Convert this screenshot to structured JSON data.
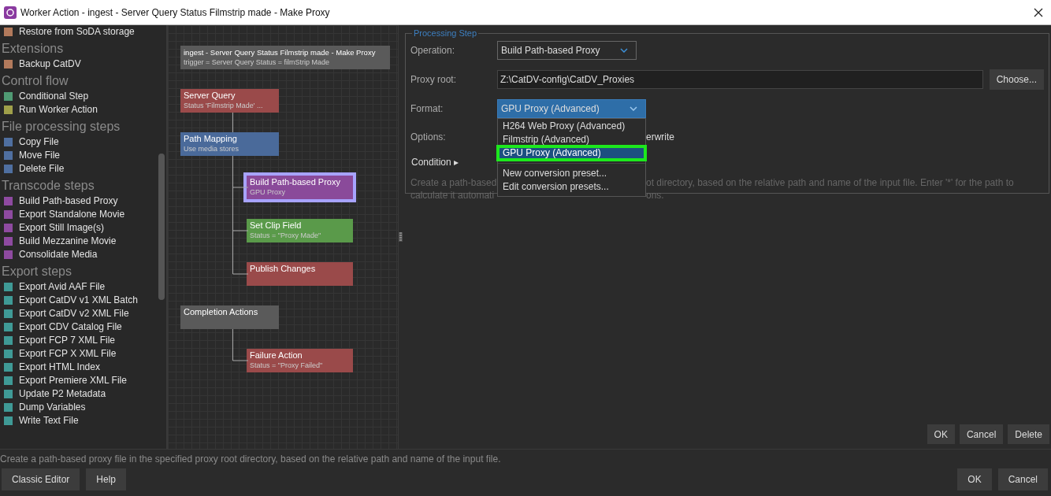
{
  "window": {
    "title": "Worker Action - ingest - Server Query Status Filmstrip made - Make Proxy"
  },
  "palette": [
    {
      "items": [
        {
          "label": "Restore from SoDA storage",
          "color": "#b27a5c"
        }
      ]
    },
    {
      "heading": "Extensions",
      "items": [
        {
          "label": "Backup CatDV",
          "color": "#b27a5c"
        }
      ]
    },
    {
      "heading": "Control flow",
      "items": [
        {
          "label": "Conditional Step",
          "color": "#4f9a73"
        },
        {
          "label": "Run Worker Action",
          "color": "#a0a04a"
        }
      ]
    },
    {
      "heading": "File processing steps",
      "items": [
        {
          "label": "Copy File",
          "color": "#4f6fa0"
        },
        {
          "label": "Move File",
          "color": "#4f6fa0"
        },
        {
          "label": "Delete File",
          "color": "#4f6fa0"
        }
      ]
    },
    {
      "heading": "Transcode steps",
      "items": [
        {
          "label": "Build Path-based Proxy",
          "color": "#8e4aa0"
        },
        {
          "label": "Export Standalone Movie",
          "color": "#8e4aa0"
        },
        {
          "label": "Export Still Image(s)",
          "color": "#8e4aa0"
        },
        {
          "label": "Build Mezzanine Movie",
          "color": "#8e4aa0"
        },
        {
          "label": "Consolidate Media",
          "color": "#8e4aa0"
        }
      ]
    },
    {
      "heading": "Export steps",
      "items": [
        {
          "label": "Export Avid AAF File",
          "color": "#3f9a96"
        },
        {
          "label": "Export CatDV v1 XML Batch",
          "color": "#3f9a96"
        },
        {
          "label": "Export CatDV v2 XML File",
          "color": "#3f9a96"
        },
        {
          "label": "Export CDV Catalog File",
          "color": "#3f9a96"
        },
        {
          "label": "Export FCP 7 XML File",
          "color": "#3f9a96"
        },
        {
          "label": "Export FCP X XML File",
          "color": "#3f9a96"
        },
        {
          "label": "Export HTML Index",
          "color": "#3f9a96"
        },
        {
          "label": "Export Premiere XML File",
          "color": "#3f9a96"
        },
        {
          "label": "Update P2 Metadata",
          "color": "#3f9a96"
        },
        {
          "label": "Dump Variables",
          "color": "#3f9a96"
        },
        {
          "label": "Write Text File",
          "color": "#3f9a96"
        }
      ]
    }
  ],
  "workflow": {
    "header": {
      "title": "ingest - Server Query Status Filmstrip made - Make Proxy",
      "subtitle": "trigger = Server Query Status = filmStrip Made"
    },
    "nodes": [
      {
        "title": "Server Query",
        "subtitle": "Status 'Filmstrip Made' ...",
        "color": "#9a4a4a",
        "selected": false
      },
      {
        "title": "Path Mapping",
        "subtitle": "Use media stores",
        "color": "#4a6a9a",
        "selected": false,
        "children": [
          {
            "title": "Build Path-based Proxy",
            "subtitle": "GPU Proxy",
            "color": "#8a4a9a",
            "selected": true
          },
          {
            "title": "Set Clip Field",
            "subtitle": "Status = \"Proxy Made\"",
            "color": "#5a9a4a",
            "selected": false
          },
          {
            "title": "Publish Changes",
            "color": "#9a4a4a",
            "selected": false
          }
        ]
      },
      {
        "title": "Completion Actions",
        "color": "#5a5a5a",
        "selected": false,
        "children": [
          {
            "title": "Failure Action",
            "subtitle": "Status = \"Proxy Failed\"",
            "color": "#9a4a4a",
            "selected": false
          }
        ]
      }
    ]
  },
  "processing_step": {
    "legend": "Processing Step",
    "operation": {
      "label": "Operation:",
      "value": "Build Path-based Proxy"
    },
    "proxy_root": {
      "label": "Proxy root:",
      "value": "Z:\\CatDV-config\\CatDV_Proxies",
      "button": "Choose..."
    },
    "format": {
      "label": "Format:",
      "value": "GPU Proxy (Advanced)",
      "expanded": true,
      "options": [
        {
          "label": "H264 Web Proxy (Advanced)",
          "selected": false,
          "outlined": false
        },
        {
          "label": "Filmstrip (Advanced)",
          "selected": false,
          "outlined": false
        },
        {
          "label": "GPU Proxy (Advanced)",
          "selected": true,
          "outlined": true
        },
        {
          "label": "New conversion preset...",
          "selected": false,
          "outlined": false,
          "separator": true
        },
        {
          "label": "Edit conversion presets...",
          "selected": false,
          "outlined": false
        }
      ]
    },
    "options": {
      "label": "Options:",
      "value": "erwrite"
    },
    "condition": {
      "label": "Condition",
      "arrow": "▸"
    },
    "description": [
      [
        "Create a path-based",
        "ot directory, based on the relative path and name of the input file. Enter '*' for the path to"
      ],
      [
        "calculate it automati",
        "ons."
      ]
    ]
  },
  "panel_buttons": [
    "OK",
    "Cancel",
    "Delete"
  ],
  "status_text": "Create a path-based proxy file in the specified proxy root directory, based on the relative path and name of the input file.",
  "footer": {
    "left_buttons": [
      "Classic Editor",
      "Help"
    ],
    "right_buttons": [
      "OK",
      "Cancel"
    ]
  }
}
